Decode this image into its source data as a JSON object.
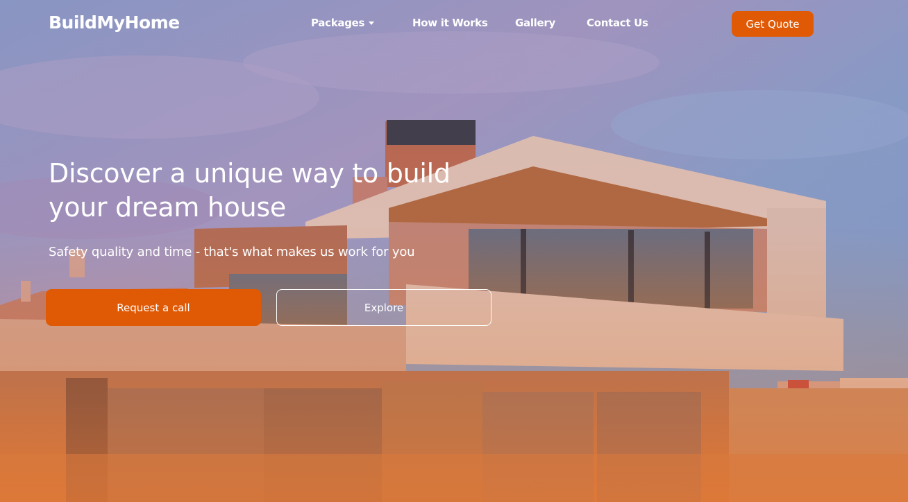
{
  "nav": {
    "brand": "BuildMyHome",
    "links": [
      {
        "label": "Packages",
        "has_dropdown": true
      },
      {
        "label": "How it Works"
      },
      {
        "label": "Gallery"
      },
      {
        "label": "Contact Us"
      }
    ],
    "cta_label": "Get Quote"
  },
  "hero": {
    "title": "Discover a unique way to build your dream house",
    "subtitle": "Safety quality and time - that's what makes us work for you",
    "primary_button": "Request a call",
    "secondary_button": "Explore",
    "background": "modern-house-photo"
  },
  "colors": {
    "accent": "#e05a06",
    "text": "#ffffff"
  }
}
